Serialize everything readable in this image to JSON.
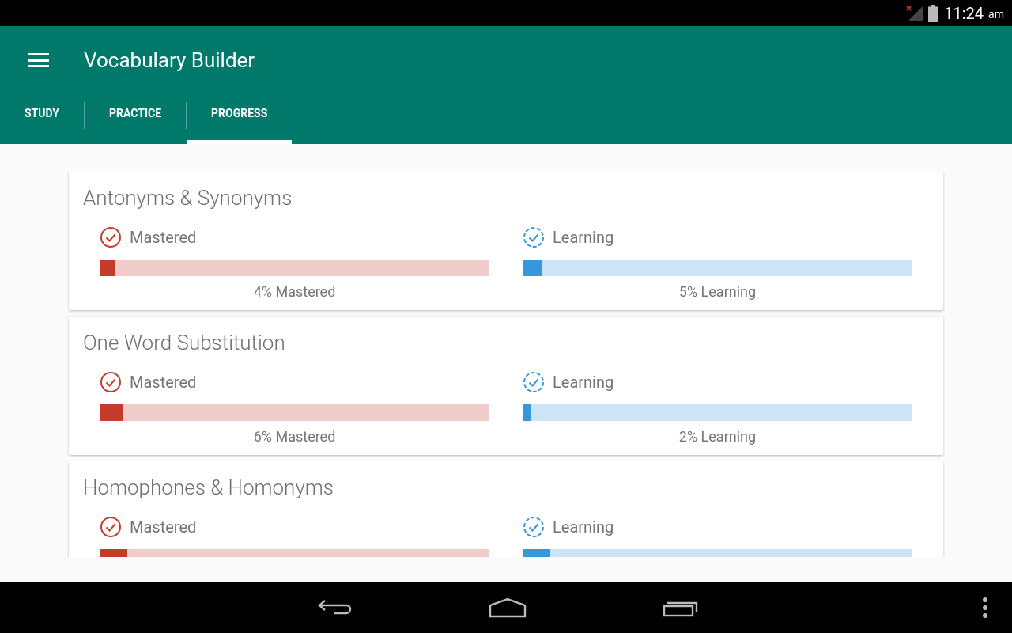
{
  "status_bar": {
    "time": "11:24",
    "period": "am"
  },
  "app_bar": {
    "title": "Vocabulary Builder"
  },
  "tabs": [
    {
      "label": "STUDY",
      "selected": false
    },
    {
      "label": "PRACTICE",
      "selected": false
    },
    {
      "label": "PROGRESS",
      "selected": true
    }
  ],
  "topics": [
    {
      "title": "Antonyms & Synonyms",
      "stats": [
        {
          "kind": "mastered",
          "label": "Mastered",
          "level": 0.04,
          "reading": "4% Mastered"
        },
        {
          "kind": "learning",
          "label": "Learning",
          "level": 0.05,
          "reading": "5% Learning"
        }
      ]
    },
    {
      "title": "One Word Substitution",
      "stats": [
        {
          "kind": "mastered",
          "label": "Mastered",
          "level": 0.06,
          "reading": "6% Mastered"
        },
        {
          "kind": "learning",
          "label": "Learning",
          "level": 0.02,
          "reading": "2% Learning"
        }
      ]
    },
    {
      "title": "Homophones & Homonyms",
      "stats": [
        {
          "kind": "mastered",
          "label": "Mastered",
          "level": 0.07
        },
        {
          "kind": "learning",
          "label": "Learning",
          "level": 0.07
        }
      ]
    }
  ]
}
